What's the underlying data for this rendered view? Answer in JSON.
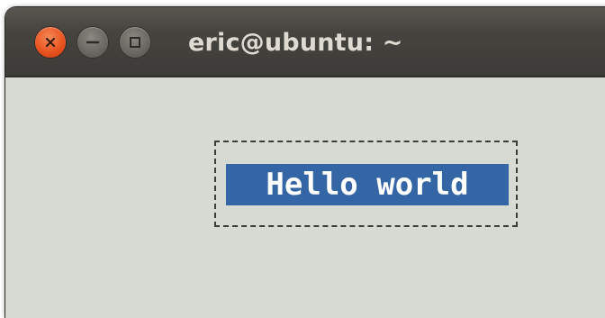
{
  "window": {
    "title": "eric@ubuntu: ~",
    "controls": {
      "close_icon": "close-icon",
      "minimize_icon": "minimize-icon",
      "maximize_icon": "maximize-icon"
    }
  },
  "terminal": {
    "label_text": "Hello world"
  },
  "colors": {
    "close_button": "#e95420",
    "titlebar": "#3c3b37",
    "terminal_background": "#d7d9d3",
    "label_background": "#3465a4",
    "label_text": "#ffffff"
  }
}
